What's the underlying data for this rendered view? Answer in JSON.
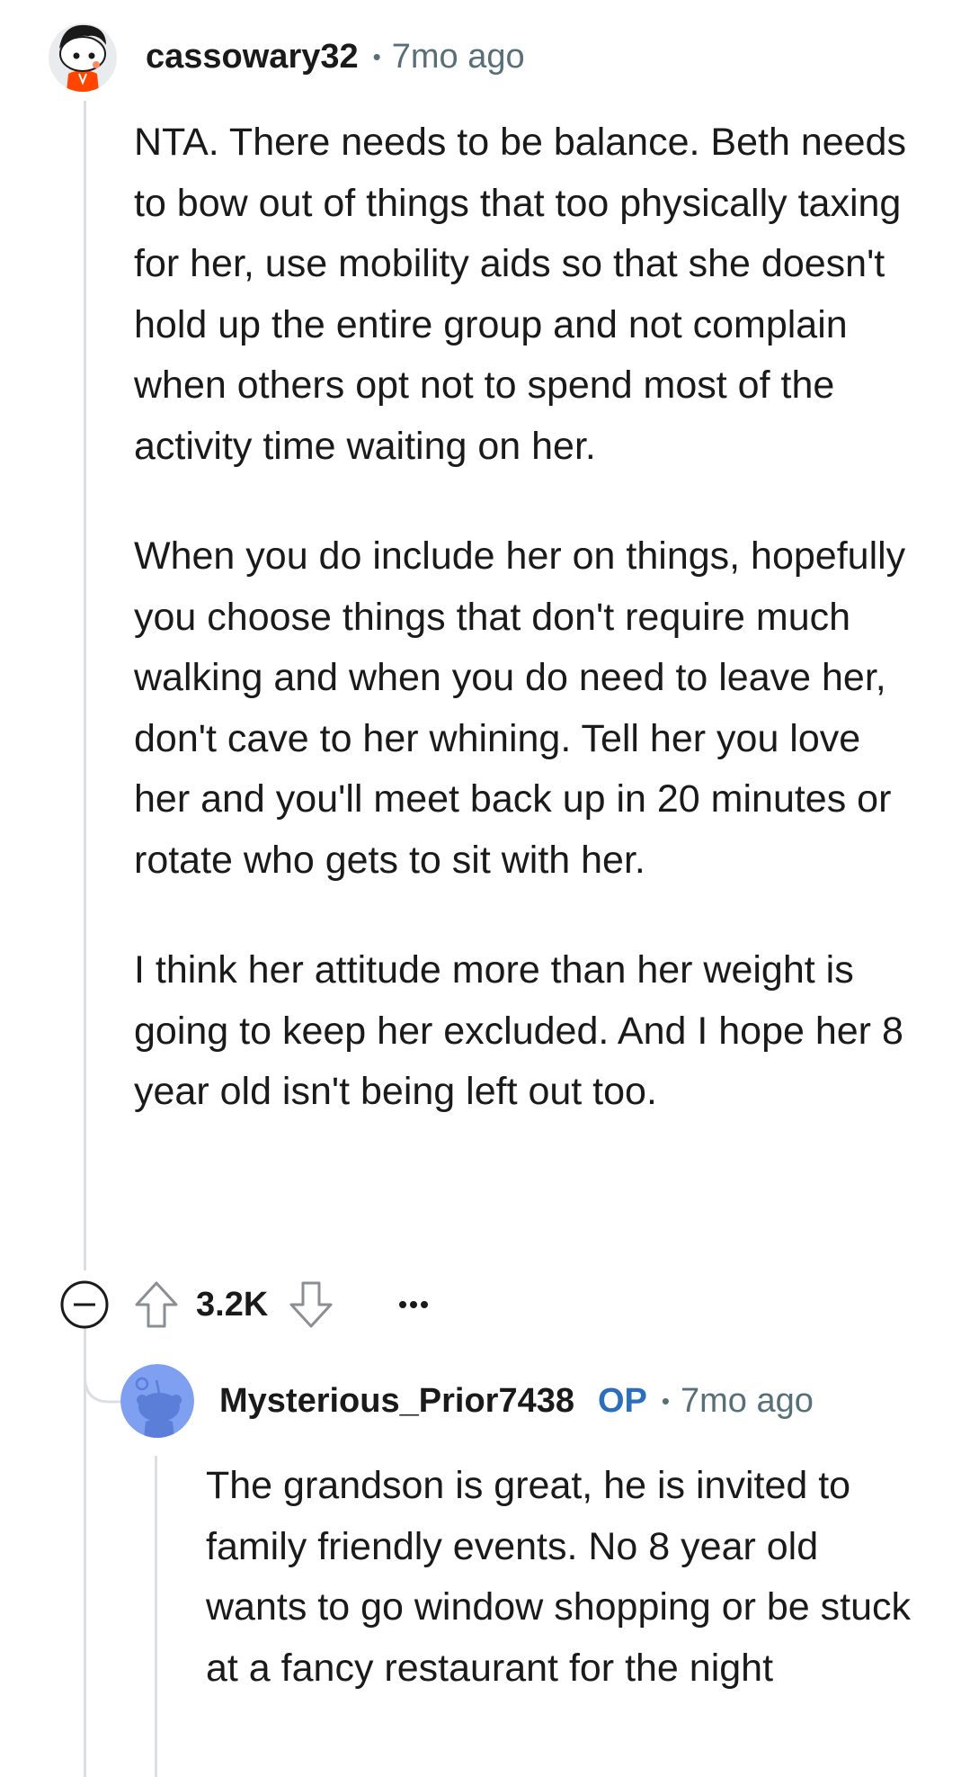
{
  "comment": {
    "author": "cassowary32",
    "time": "7mo ago",
    "paragraphs": [
      "NTA. There needs to be balance. Beth needs to bow out of things that too physically taxing for her, use mobility aids so that she doesn't hold up the entire group and not complain when others opt not to spend most of the activity time waiting on her.",
      "When you do include her on things, hopefully you choose things that don't require much walking and when you do need to leave her, don't cave to her whining. Tell her you love her and you'll meet back up in 20 minutes or rotate who gets to sit with her.",
      "I think her attitude more than her weight is going to keep her excluded. And I hope her 8 year old isn't being left out too."
    ],
    "score": "3.2K",
    "icons": {
      "collapse": "collapse-minus-icon",
      "upvote": "upvote-arrow-icon",
      "downvote": "downvote-arrow-icon",
      "more": "more-options-icon"
    }
  },
  "reply": {
    "author": "Mysterious_Prior7438",
    "op_badge": "OP",
    "time": "7mo ago",
    "paragraphs": [
      "The grandson is great, he is invited to family friendly events. No 8 year old wants to go window shopping or be stuck at a fancy restaurant for the night"
    ]
  },
  "colors": {
    "text": "#1a1a1b",
    "meta": "#576f76",
    "op": "#2a6ebd",
    "thread_line": "#dcdfe2",
    "icon_outline": "#8a8f93"
  }
}
